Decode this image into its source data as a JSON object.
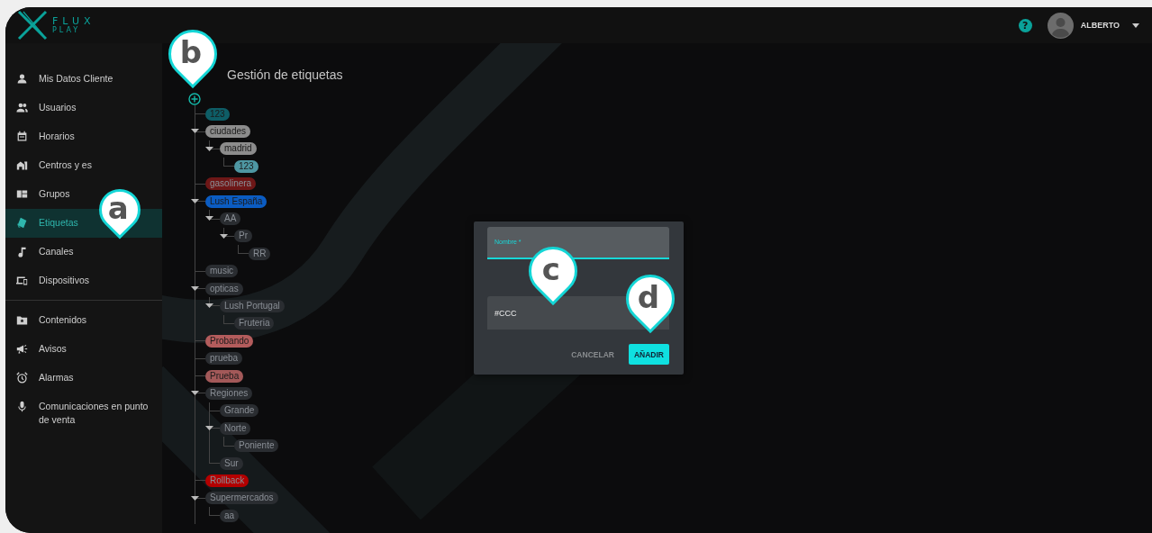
{
  "logo": {
    "word": "FLUX",
    "subword": "PLAY"
  },
  "top_bar": {
    "help": "?",
    "user": "ALBERTO"
  },
  "sidebar": {
    "sections": [
      [
        {
          "label": "Mis Datos Cliente",
          "selected": false
        },
        {
          "label": "Usuarios",
          "selected": false
        },
        {
          "label": "Horarios",
          "selected": false
        },
        {
          "label": "Centros y es",
          "selected": false
        },
        {
          "label": "Grupos",
          "selected": false
        },
        {
          "label": "Etiquetas",
          "selected": true
        },
        {
          "label": "Canales",
          "selected": false
        },
        {
          "label": "Dispositivos",
          "selected": false
        }
      ],
      [
        {
          "label": "Contenidos",
          "selected": false
        },
        {
          "label": "Avisos",
          "selected": false
        },
        {
          "label": "Alarmas",
          "selected": false
        },
        {
          "label": "Comunicaciones en punto de venta",
          "selected": false
        }
      ]
    ]
  },
  "page": {
    "title": "Gestión de etiquetas"
  },
  "tags": [
    {
      "label": "123",
      "color": "#0e5d66"
    },
    {
      "label": "ciudades",
      "color": "#8c8c8c",
      "children": [
        {
          "label": "madrid",
          "color": "#8c8c8c",
          "children": [
            {
              "label": "123",
              "color": "#4e97a3"
            }
          ]
        }
      ]
    },
    {
      "label": "gasolinera",
      "color": "#6e1717"
    },
    {
      "label": "Lush España",
      "color": "#0b5cc2",
      "children": [
        {
          "label": "AA",
          "color": "#2a2d31",
          "children": [
            {
              "label": "Pr",
              "color": "#2a2d31",
              "children": [
                {
                  "label": "RR",
                  "color": "#2a2d31"
                }
              ]
            }
          ]
        }
      ]
    },
    {
      "label": "music",
      "color": "#2a2d31"
    },
    {
      "label": "opticas",
      "color": "#2a2d31",
      "children": [
        {
          "label": "Lush Portugal",
          "color": "#2a2d31",
          "children": [
            {
              "label": "Fruteria",
              "color": "#2a2d31"
            }
          ]
        }
      ]
    },
    {
      "label": "Probando",
      "color": "#b35c5c"
    },
    {
      "label": "prueba",
      "color": "#2a2d31"
    },
    {
      "label": "Prueba",
      "color": "#a35959"
    },
    {
      "label": "Regiones",
      "color": "#2a2d31",
      "children": [
        {
          "label": "Grande",
          "color": "#2a2d31"
        },
        {
          "label": "Norte",
          "color": "#2a2d31",
          "children": [
            {
              "label": "Poniente",
              "color": "#2a2d31"
            }
          ]
        },
        {
          "label": "Sur",
          "color": "#2a2d31"
        }
      ]
    },
    {
      "label": "Rollback",
      "color": "#b30000"
    },
    {
      "label": "Supermercados",
      "color": "#2a2d31",
      "children": [
        {
          "label": "aa",
          "color": "#2a2d31"
        }
      ]
    }
  ],
  "dialog": {
    "name_field": {
      "label": "Nombre *"
    },
    "color_field": {
      "value": "#CCC"
    },
    "buttons": [
      {
        "label": "CANCELAR",
        "kind": "text"
      },
      {
        "label": "AÑADIR",
        "kind": "primary"
      }
    ]
  },
  "callouts": [
    {
      "label": "a"
    },
    {
      "label": "b"
    },
    {
      "label": "c"
    },
    {
      "label": "d"
    }
  ]
}
